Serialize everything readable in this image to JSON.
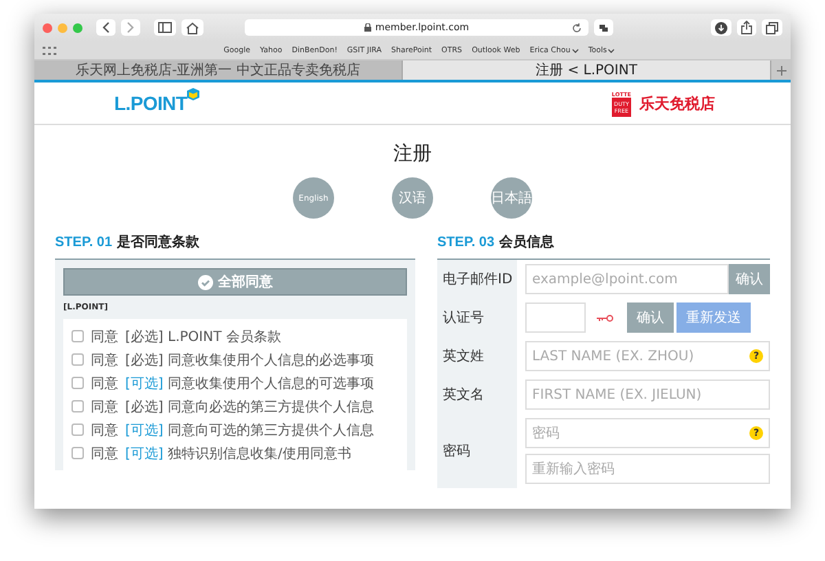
{
  "browser": {
    "url": "member.lpoint.com",
    "bookmarks": [
      {
        "label": "Google",
        "menu": false
      },
      {
        "label": "Yahoo",
        "menu": false
      },
      {
        "label": "DinBenDon!",
        "menu": false
      },
      {
        "label": "GSIT JIRA",
        "menu": false
      },
      {
        "label": "SharePoint",
        "menu": false
      },
      {
        "label": "OTRS",
        "menu": false
      },
      {
        "label": "Outlook Web",
        "menu": false
      },
      {
        "label": "Erica Chou",
        "menu": true
      },
      {
        "label": "Tools",
        "menu": true
      }
    ],
    "tabs": [
      {
        "title": "乐天网上免税店-亚洲第一 中文正品专卖免税店",
        "selected": false
      },
      {
        "title": "注册 < L.POINT",
        "selected": true
      }
    ]
  },
  "header": {
    "logo": "L.POINT",
    "partner": {
      "top": "LOTTE",
      "badge": "DUTY FREE",
      "name": "乐天免税店"
    }
  },
  "page_title": "注册",
  "languages": [
    "English",
    "汉语",
    "日本語"
  ],
  "step1": {
    "step": "STEP. 01",
    "title": "是否同意条款",
    "agree_all": "全部同意",
    "group": "[L.POINT]",
    "items": [
      {
        "checked": false,
        "agree": "同意",
        "tag": "[必选]",
        "required": true,
        "text": "L.POINT 会员条款"
      },
      {
        "checked": false,
        "agree": "同意",
        "tag": "[必选]",
        "required": true,
        "text": "同意收集使用个人信息的必选事项"
      },
      {
        "checked": false,
        "agree": "同意",
        "tag": "[可选]",
        "required": false,
        "text": "同意收集使用个人信息的可选事项"
      },
      {
        "checked": false,
        "agree": "同意",
        "tag": "[必选]",
        "required": true,
        "text": "同意向必选的第三方提供个人信息"
      },
      {
        "checked": false,
        "agree": "同意",
        "tag": "[可选]",
        "required": false,
        "text": "同意向可选的第三方提供个人信息"
      },
      {
        "checked": false,
        "agree": "同意",
        "tag": "[可选]",
        "required": false,
        "text": "独特识别信息收集/使用同意书"
      }
    ]
  },
  "step3": {
    "step": "STEP. 03",
    "title": "会员信息",
    "rows": [
      {
        "label": "电子邮件ID",
        "kind": "input",
        "fields": [
          {
            "placeholder": "example@lpoint.com"
          }
        ],
        "buttons": [
          {
            "label": "确认",
            "primary": false
          }
        ]
      },
      {
        "label": "认证号",
        "kind": "verify",
        "buttons": [
          {
            "label": "确认",
            "primary": false
          },
          {
            "label": "重新发送",
            "primary": true
          }
        ]
      },
      {
        "label": "英文姓",
        "kind": "input",
        "fields": [
          {
            "placeholder": "LAST NAME (EX. ZHOU)",
            "help": "?"
          }
        ]
      },
      {
        "label": "英文名",
        "kind": "input",
        "fields": [
          {
            "placeholder": "FIRST NAME (EX. JIELUN)"
          }
        ]
      },
      {
        "label": "密码",
        "kind": "input",
        "fields": [
          {
            "placeholder": "密码",
            "help": "?"
          },
          {
            "placeholder": "重新输入密码"
          }
        ]
      }
    ]
  }
}
